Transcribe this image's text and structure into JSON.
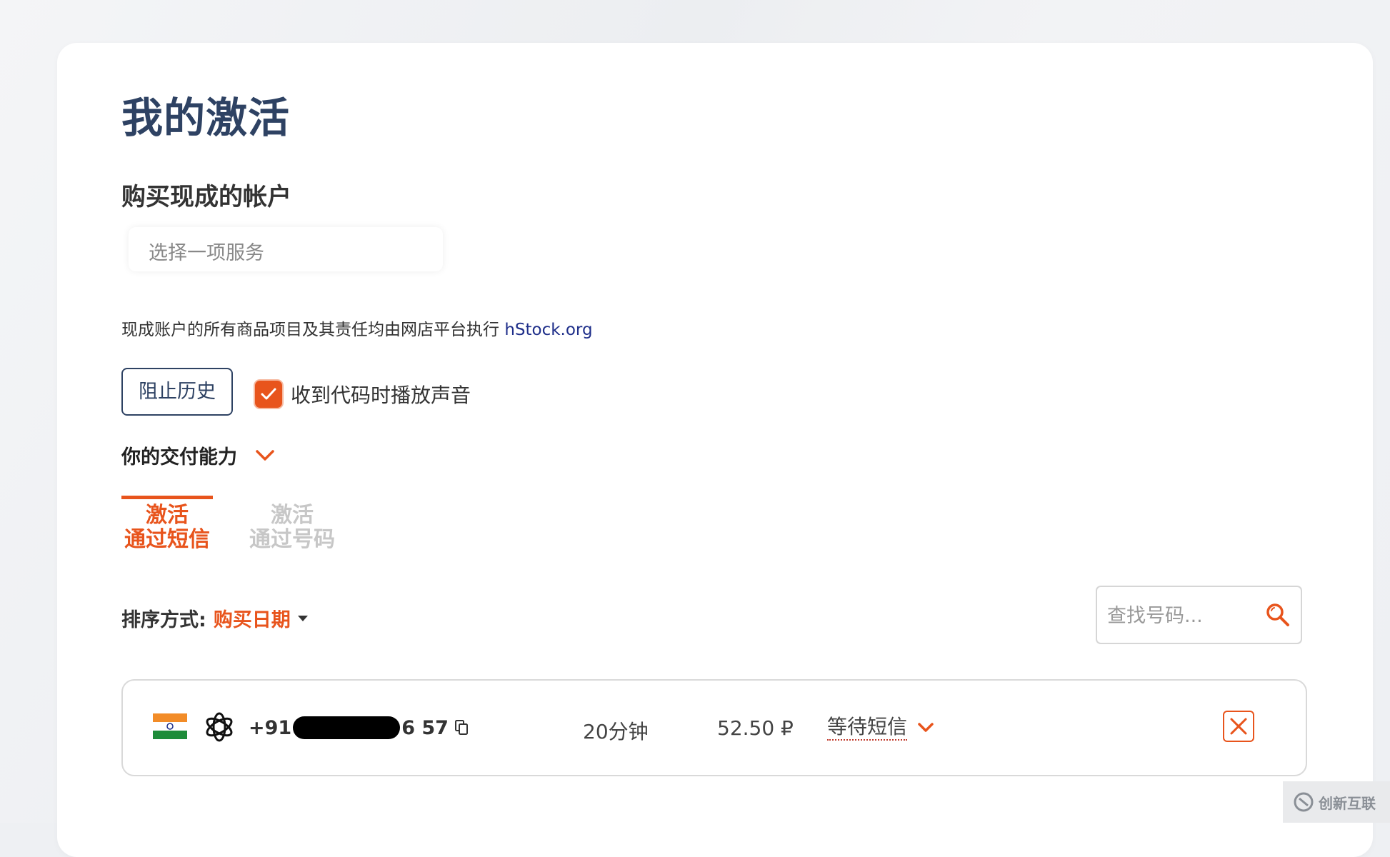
{
  "page": {
    "title": "我的激活"
  },
  "ready_accounts": {
    "section_title": "购买现成的帐户",
    "select_placeholder": "选择一项服务",
    "note_text": "现成账户的所有商品项目及其责任均由网店平台执行 ",
    "note_link": "hStock.org"
  },
  "controls": {
    "block_history_label": "阻止历史",
    "sound_label": "收到代码时播放声音",
    "sound_checked": true
  },
  "capacity": {
    "label": "你的交付能力"
  },
  "tabs": [
    {
      "line1": "激活",
      "line2": "通过短信",
      "active": true
    },
    {
      "line1": "激活",
      "line2": "通过号码",
      "active": false
    }
  ],
  "sort": {
    "label": "排序方式:",
    "value": "购买日期"
  },
  "search": {
    "placeholder": "查找号码..."
  },
  "activations": [
    {
      "country_flag": "india-flag-icon",
      "service_icon": "openai-icon",
      "phone_prefix": "+91",
      "phone_suffix": "6 57",
      "duration": "20分钟",
      "price": "52.50 ₽",
      "status": "等待短信"
    }
  ],
  "colors": {
    "accent": "#e8541c",
    "title": "#2e4263",
    "link": "#1f2f8a",
    "tab_inactive": "#c7c7c7"
  },
  "watermark": {
    "text": "创新互联"
  }
}
